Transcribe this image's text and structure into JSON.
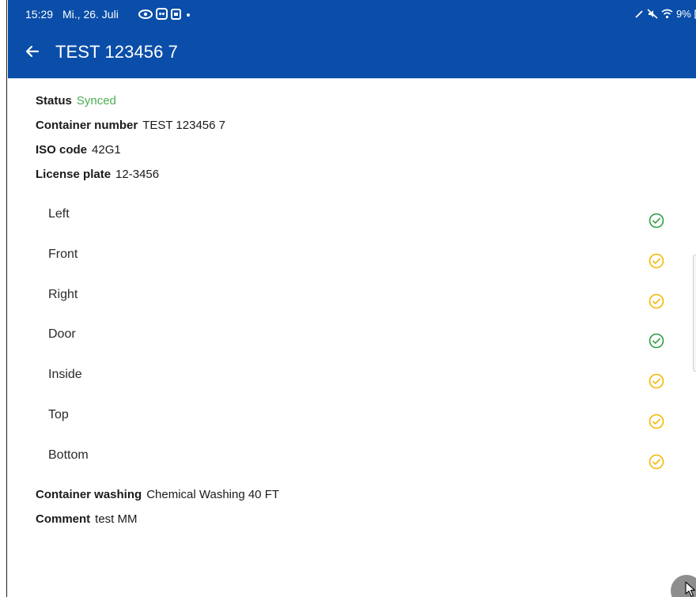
{
  "statusbar": {
    "time": "15:29",
    "date": "Mi., 26. Juli",
    "battery": "9%"
  },
  "appbar": {
    "title": "TEST 123456 7",
    "back_icon": "arrow-left-icon"
  },
  "details": {
    "status": {
      "label": "Status",
      "value": "Synced",
      "value_color": "#4caf50"
    },
    "container_number": {
      "label": "Container number",
      "value": "TEST 123456 7"
    },
    "iso_code": {
      "label": "ISO code",
      "value": "42G1"
    },
    "license_plate": {
      "label": "License plate",
      "value": "12-3456"
    }
  },
  "views": [
    {
      "label": "Left",
      "state": "complete",
      "color": "#2e9e44",
      "icon": "check-circle-icon"
    },
    {
      "label": "Front",
      "state": "pending",
      "color": "#f5b800",
      "icon": "check-circle-icon"
    },
    {
      "label": "Right",
      "state": "pending",
      "color": "#f5b800",
      "icon": "check-circle-icon"
    },
    {
      "label": "Door",
      "state": "complete",
      "color": "#2e9e44",
      "icon": "check-circle-icon"
    },
    {
      "label": "Inside",
      "state": "pending",
      "color": "#f5b800",
      "icon": "check-circle-icon"
    },
    {
      "label": "Top",
      "state": "pending",
      "color": "#f5b800",
      "icon": "check-circle-icon"
    },
    {
      "label": "Bottom",
      "state": "pending",
      "color": "#f5b800",
      "icon": "check-circle-icon"
    }
  ],
  "footer_details": {
    "container_washing": {
      "label": "Container washing",
      "value": "Chemical Washing 40 FT"
    },
    "comment": {
      "label": "Comment",
      "value": "test MM"
    }
  },
  "colors": {
    "header_bg": "#0a4ea9",
    "complete": "#2e9e44",
    "pending": "#f5b800"
  }
}
